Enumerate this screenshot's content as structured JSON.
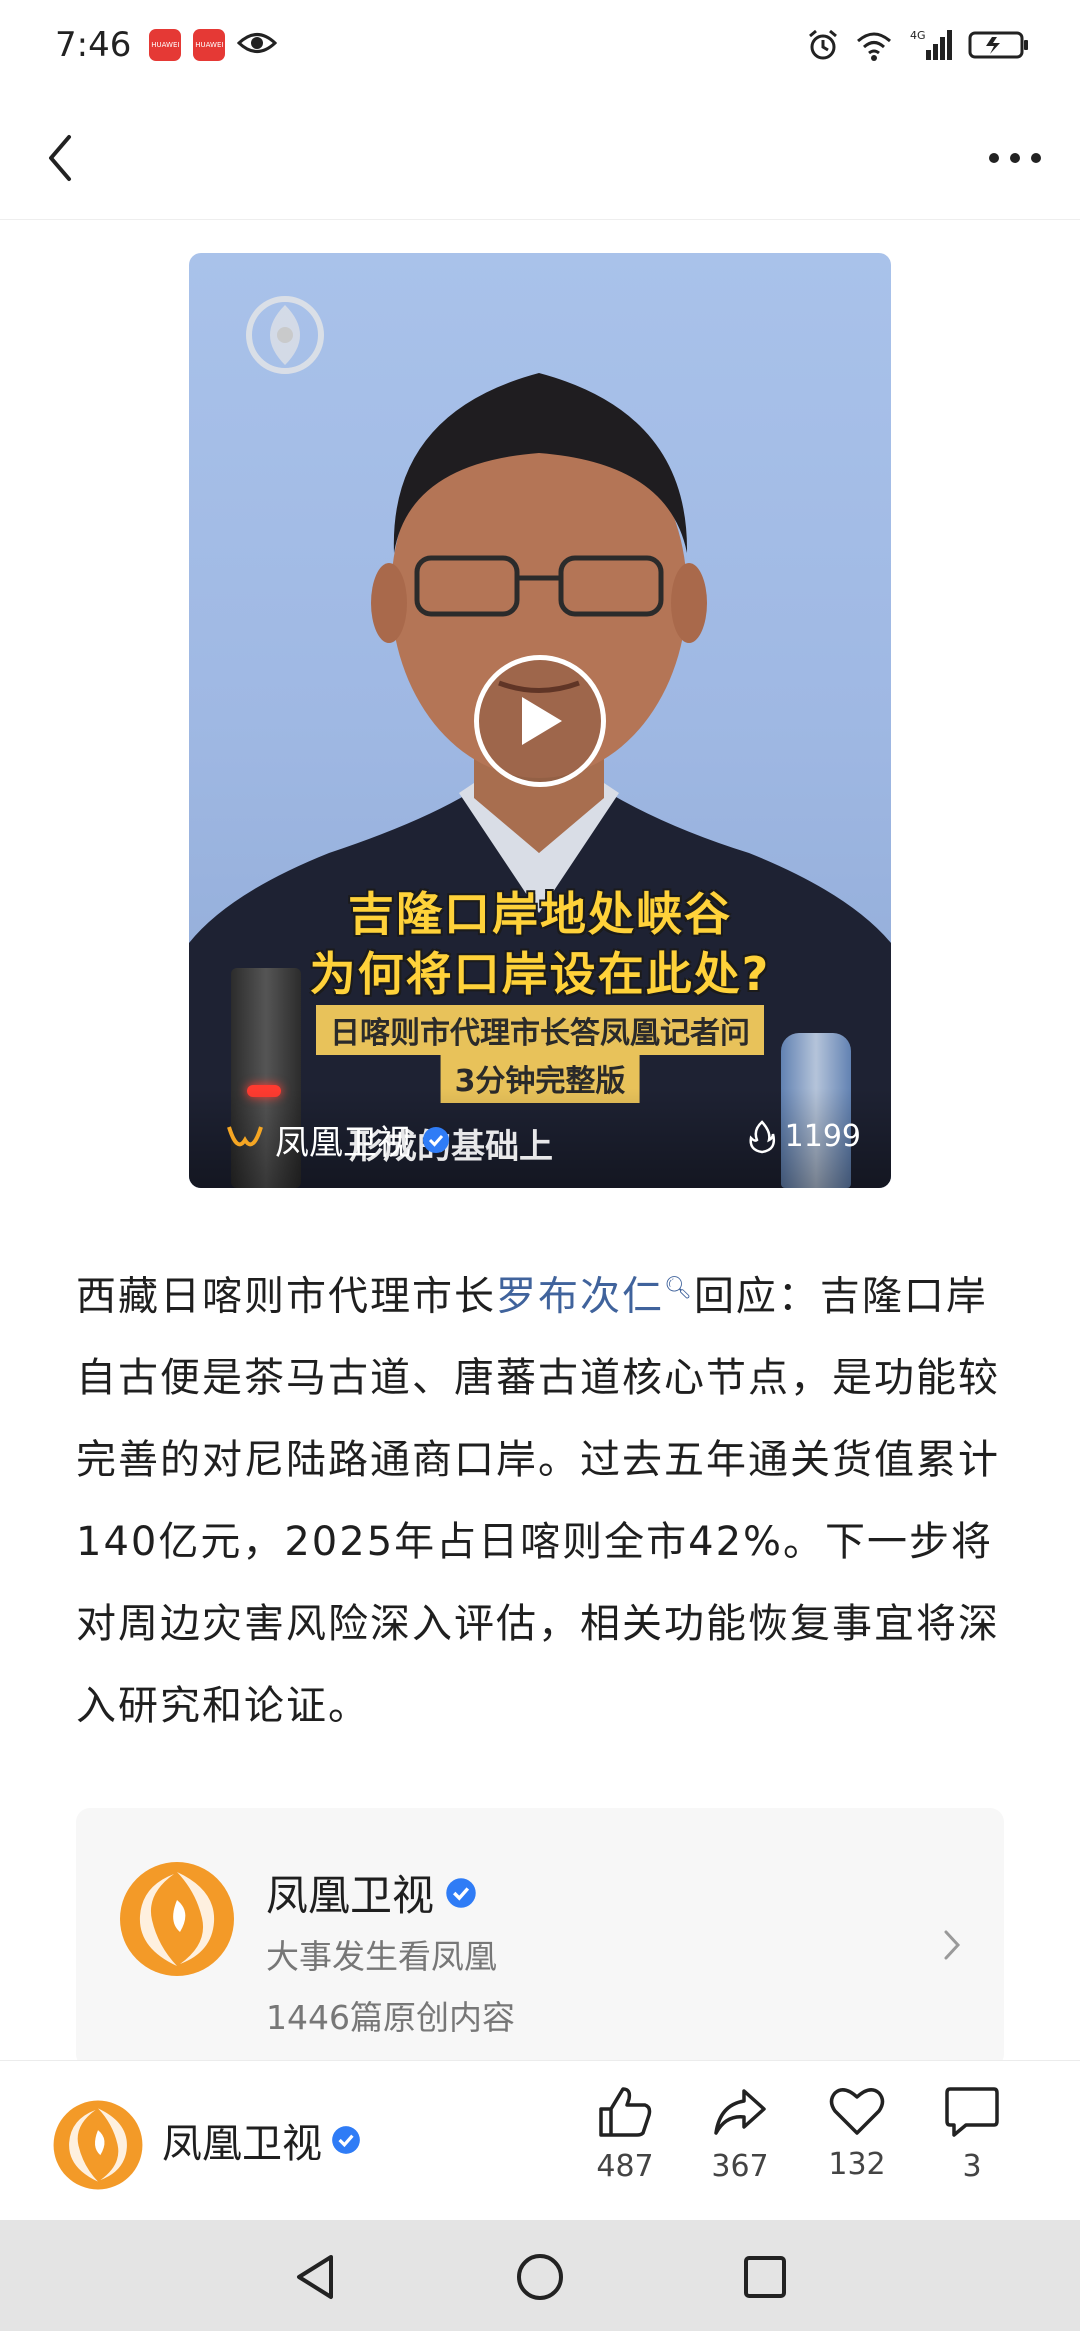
{
  "status_bar": {
    "time": "7:46",
    "app_badges": [
      "HUAWEI",
      "HUAWEI"
    ],
    "network": "4G",
    "wifi_label": "6"
  },
  "top_nav": {
    "back_icon": "chevron-left-icon",
    "more_icon": "more-horizontal-icon"
  },
  "video": {
    "caption_line1": "吉隆口岸地处峡谷",
    "caption_line2": "为何将口岸设在此处?",
    "sub_line1": "日喀则市代理市长答凤凰记者问",
    "sub_line2": "3分钟完整版",
    "source_name": "凤凰卫视",
    "subtitle_overlay": "形成的基础上",
    "views": "1199"
  },
  "article": {
    "prefix": "西藏日喀则市代理市长",
    "link_text": "罗布次仁",
    "body": "回应：吉隆口岸自古便是茶马古道、唐蕃古道核心节点，是功能较完善的对尼陆路通商口岸。过去五年通关货值累计140亿元，2025年占日喀则全市42%。下一步将对周边灾害风险深入评估，相关功能恢复事宜将深入研究和论证。"
  },
  "author_card": {
    "name": "凤凰卫视",
    "slogan": "大事发生看凤凰",
    "count": "1446篇原创内容"
  },
  "action_bar": {
    "name": "凤凰卫视",
    "likes": "487",
    "shares": "367",
    "favorites": "132",
    "comments": "3"
  },
  "colors": {
    "link": "#40639c",
    "verified": "#2f7cf6",
    "phoenix_orange": "#f08a1c"
  }
}
